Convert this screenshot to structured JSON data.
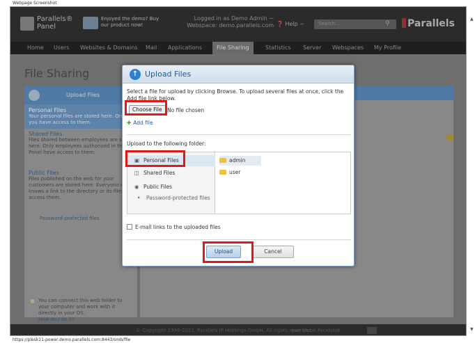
{
  "screenshot_label": "Webpage Screenshot",
  "url": "https://plesk11-power.demo.parallels.com:8443/smb/file",
  "header": {
    "logo_text": "Parallels® Panel",
    "promo_text": "Enjoyed the demo? Buy our product now!",
    "logged_in": "Logged in as Demo Admin ~",
    "webspace": "Webspace: demo.parallels.com",
    "help": "Help ~",
    "search_placeholder": "Search...",
    "brand": "Parallels"
  },
  "nav": {
    "items": [
      "Home",
      "Users",
      "Websites & Domains",
      "Mail",
      "Applications",
      "File Sharing",
      "Statistics",
      "Server",
      "Webspaces",
      "My Profile"
    ],
    "active": "File Sharing"
  },
  "page": {
    "title": "File Sharing",
    "left_tab": "Upload Files",
    "personal": {
      "title": "Personal Files",
      "desc": "Your personal files are stored here. Only you have access to them."
    },
    "shared": {
      "title": "Shared Files",
      "desc": "Files shared between employees are stored here. Only employees authorized in the Panel have access to them."
    },
    "public": {
      "title": "Public Files",
      "desc": "Files published on the web for your customers are stored here. Everyone who knows a link to the directory or its files can access them."
    },
    "protected": "Password-protected files",
    "note": "You can connect this web folder to your computer and work with it directly in your OS.",
    "note_link": "How do I do it?"
  },
  "footer": {
    "copyright": "© Copyright 1999-2012, Parallels IP Holdings GmbH. All rights reserved.",
    "facebook": "Join Us on Facebook"
  },
  "dialog": {
    "title": "Upload Files",
    "instructions": "Select a file for upload by clicking Browse. To upload several files at once, click the Add file link below.",
    "choose_file": "Choose File",
    "no_file": "No file chosen",
    "add_file": "Add file",
    "upload_to": "Upload to the following folder:",
    "tree": [
      "Personal Files",
      "Shared Files",
      "Public Files",
      "Password-protected files"
    ],
    "folders": [
      "admin",
      "user"
    ],
    "email_links": "E-mail links to the uploaded files",
    "upload": "Upload",
    "cancel": "Cancel"
  },
  "colors": {
    "highlight": "#e01818",
    "dialog_title": "#1f5a9a",
    "link": "#2a5db0",
    "folder": "#f0c040"
  }
}
